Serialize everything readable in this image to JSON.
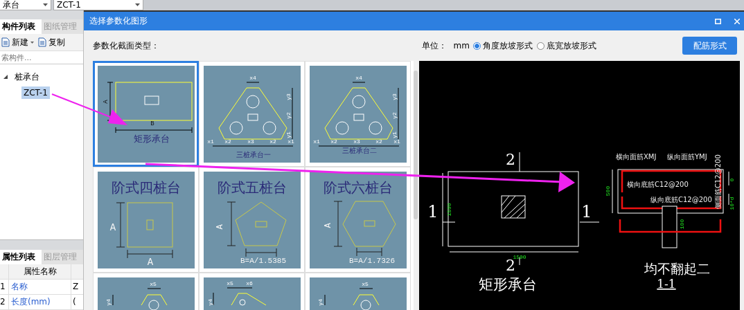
{
  "top_bar": {
    "dropdowns": [
      "承台",
      "ZCT-1"
    ]
  },
  "left_panel": {
    "tabs": [
      {
        "label": "构件列表",
        "selected": true
      },
      {
        "label": "图纸管理",
        "selected": false
      }
    ],
    "toolbar": [
      "新建",
      "复制"
    ],
    "search": {
      "placeholder": "索构件..."
    },
    "tree": [
      {
        "label": "桩承台",
        "expanded": true,
        "selected": false,
        "children": [
          {
            "label": "ZCT-1",
            "selected": true
          }
        ]
      }
    ],
    "bottom_tabs": [
      {
        "label": "属性列表",
        "selected": true
      },
      {
        "label": "图层管理",
        "selected": false
      }
    ],
    "properties": {
      "column": "属性名称",
      "rows": [
        {
          "index": "1",
          "name": "名称",
          "value": "Z"
        },
        {
          "index": "2",
          "name": "长度(mm)",
          "value": "("
        }
      ]
    }
  },
  "dialog": {
    "title": "选择参数化图形",
    "section_label": "参数化截面类型：",
    "unit_label": "单位：",
    "unit": "mm",
    "slope_options": [
      {
        "label": "角度放坡形式",
        "selected": true
      },
      {
        "label": "底宽放坡形式",
        "selected": false
      }
    ],
    "rebar_button": "配筋形式",
    "shapes": [
      {
        "kind": "rect",
        "selected": true,
        "title": "矩形承台",
        "labels": [
          "A",
          "B"
        ]
      },
      {
        "kind": "tri1",
        "selected": false,
        "title": "三桩承台一",
        "labels": [
          "x4",
          "y3",
          "y2",
          "y1",
          "x1",
          "x2",
          "x3",
          "x2",
          "x1"
        ]
      },
      {
        "kind": "tri2",
        "selected": false,
        "title": "三桩承台二",
        "labels": [
          "x4",
          "y3",
          "y2",
          "y1",
          "x1",
          "x2",
          "x3",
          "x2",
          "x1"
        ]
      },
      {
        "kind": "step4",
        "selected": false,
        "title": "阶式四桩台",
        "labels": [
          "A",
          "A"
        ]
      },
      {
        "kind": "step5",
        "selected": false,
        "title": "阶式五桩台",
        "labels": [
          "A",
          "B=A/1.5385"
        ]
      },
      {
        "kind": "step6",
        "selected": false,
        "title": "阶式六桩台",
        "labels": [
          "A",
          "B=A/1.7326"
        ]
      },
      {
        "kind": "partial1",
        "selected": false,
        "labels": [
          "x5",
          "y4"
        ]
      },
      {
        "kind": "partial2",
        "selected": false,
        "labels": [
          "x5",
          "x6",
          "y4"
        ]
      },
      {
        "kind": "partial1",
        "selected": false,
        "labels": [
          "x5",
          "y4"
        ]
      }
    ],
    "preview": {
      "plan_marks": [
        "2",
        "2",
        "1",
        "1"
      ],
      "plan_dims": [
        "1500",
        "1500"
      ],
      "plan_title": "矩形承台",
      "rebar_labels": [
        "横向面筋XMJ",
        "纵向面筋YMJ",
        "横向底筋C12@200",
        "纵向底筋C12@200",
        "侧面筋C12@200"
      ],
      "section_dims": [
        "500",
        "0",
        "10*d",
        "100"
      ],
      "section_title": "均不翻起二",
      "section_name": "1-1"
    }
  }
}
